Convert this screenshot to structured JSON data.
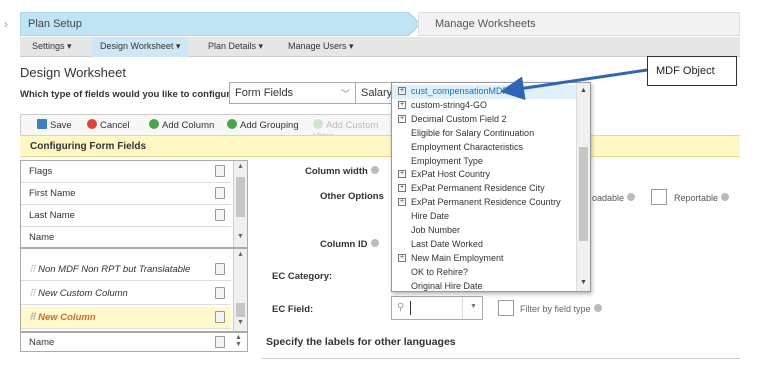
{
  "process": {
    "step1": "Plan Setup",
    "step2": "Manage Worksheets"
  },
  "menu": [
    "Settings ▾",
    "Design Worksheet ▾",
    "Plan Details ▾",
    "Manage Users ▾"
  ],
  "page_title": "Design Worksheet",
  "config": {
    "question": "Which type of fields would you like to configure:",
    "type_value": "Form Fields",
    "second_value": "Salary"
  },
  "toolbar": {
    "save": "Save",
    "cancel": "Cancel",
    "add_column": "Add Column",
    "add_grouping": "Add Grouping",
    "add_custom_view": "Add Custom View"
  },
  "section_title": "Configuring Form Fields",
  "list_top": [
    "Flags",
    "First Name",
    "Last Name",
    "Name"
  ],
  "list_mid": [
    "Non MDF Non RPT but Translatable",
    "New Custom Column",
    "New Column"
  ],
  "list_bottom": "Name",
  "form": {
    "column_width": "Column width",
    "other_options": "Other Options",
    "loadable": "oadable",
    "reportable": "Reportable",
    "column_id": "Column ID",
    "ec_category": "EC Category:",
    "ec_field": "EC Field:",
    "filter_label": "Filter by field type",
    "languages": "Specify the labels for other languages"
  },
  "dropdown": {
    "items": [
      {
        "label": "cust_compensationMDF",
        "plus": true,
        "highlight": true
      },
      {
        "label": "custom-string4-GO",
        "plus": true
      },
      {
        "label": "Decimal Custom Field 2",
        "plus": true
      },
      {
        "label": "Eligible for Salary Continuation"
      },
      {
        "label": "Employment Characteristics"
      },
      {
        "label": "Employment Type"
      },
      {
        "label": "ExPat Host Country",
        "plus": true
      },
      {
        "label": "ExPat Permanent Residence City",
        "plus": true
      },
      {
        "label": "ExPat Permanent Residence Country",
        "plus": true
      },
      {
        "label": "Hire Date"
      },
      {
        "label": "Job Number"
      },
      {
        "label": "Last Date Worked"
      },
      {
        "label": "New Main Employment",
        "plus": true
      },
      {
        "label": "OK to Rehire?"
      },
      {
        "label": "Original Hire Date"
      }
    ]
  },
  "callout": "MDF Object",
  "colors": {
    "accent": "#cfe6f4",
    "highlight": "#fff8c4",
    "arrow": "#2f66b3"
  }
}
